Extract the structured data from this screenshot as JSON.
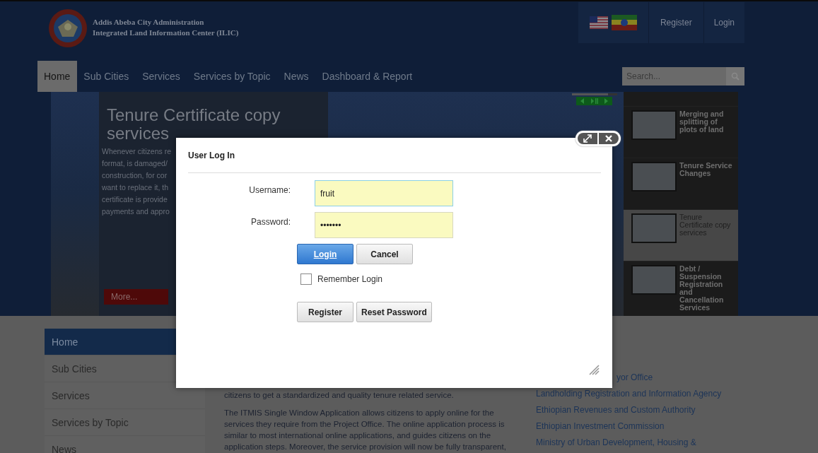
{
  "header": {
    "logo_lines": [
      "Addis Abeba City Administration",
      "Integrated Land Information Center (ILIC)"
    ],
    "account_links": [
      "Register",
      "Login"
    ]
  },
  "nav": {
    "items": [
      {
        "label": "Home",
        "selected": true
      },
      {
        "label": "Sub Cities",
        "selected": false
      },
      {
        "label": "Services",
        "selected": false
      },
      {
        "label": "Services by Topic",
        "selected": false
      },
      {
        "label": "News",
        "selected": false
      },
      {
        "label": "Dashboard & Report",
        "selected": false
      }
    ],
    "search": {
      "placeholder": "Search..."
    }
  },
  "hero": {
    "title": "Tenure Certificate copy services",
    "lines": [
      "Whenever citizens re",
      "format, is damaged/",
      "construction, for cor",
      "want to replace it, th",
      "certificate is provide",
      "payments and appro"
    ],
    "more_button": "More...",
    "progress": {
      "level": 0.8
    },
    "slides": [
      {
        "title": "Merging and splitting of plots of land",
        "selected": false
      },
      {
        "title": "Tenure Service Changes",
        "selected": false
      },
      {
        "title": "Tenure Certificate copy services",
        "selected": true
      },
      {
        "title": "Debt / Suspension Registration and Cancellation Services",
        "selected": false
      }
    ]
  },
  "sidebar": {
    "items": [
      {
        "label": "Home",
        "selected": true
      },
      {
        "label": "Sub Cities",
        "selected": false
      },
      {
        "label": "Services",
        "selected": false
      },
      {
        "label": "Services by Topic",
        "selected": false
      },
      {
        "label": "News",
        "selected": false
      }
    ]
  },
  "content": {
    "paragraphs": [
      "citizens to get a standardized and quality tenure related service.",
      "The ITMIS Single Window Application allows citizens to apply online for the services they require from the Project Office. The online application process is similar to most international online applications, and guides citizens on the application steps. Moreover, the service provision will now be fully transparent,"
    ]
  },
  "links": [
    "yor Office",
    "Landholding Registration and Information Agency",
    "Ethiopian Revenues and Custom Authority",
    "Ethiopian Investment Commission",
    "Ministry of Urban Development, Housing &"
  ],
  "dialog": {
    "title": "User Log In",
    "fields": [
      {
        "label": "Username:",
        "value": "fruit",
        "focused": true
      },
      {
        "label": "Password:",
        "value": "•••••••",
        "focused": false
      }
    ],
    "primary_buttons": [
      {
        "label": "Login",
        "kind": "primary"
      },
      {
        "label": "Cancel",
        "kind": "default"
      }
    ],
    "remember": {
      "label": "Remember Login",
      "checked": false
    },
    "secondary_buttons": [
      "Register",
      "Reset Password"
    ]
  }
}
